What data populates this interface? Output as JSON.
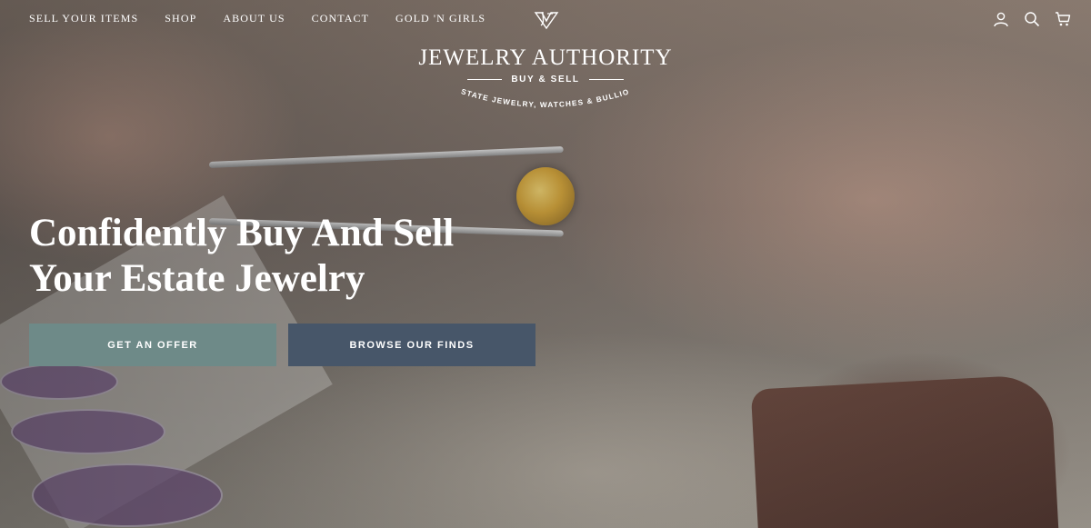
{
  "nav": {
    "items": [
      {
        "label": "SELL YOUR ITEMS"
      },
      {
        "label": "SHOP"
      },
      {
        "label": "ABOUT US"
      },
      {
        "label": "CONTACT"
      },
      {
        "label": "GOLD 'N GIRLS"
      }
    ]
  },
  "brand": {
    "title": "JEWELRY AUTHORITY",
    "subtitle": "BUY & SELL",
    "tagline": "ESTATE JEWELRY, WATCHES & BULLION",
    "logo_icon": "jv-monogram-icon"
  },
  "header_icons": [
    "account-icon",
    "search-icon",
    "cart-icon"
  ],
  "hero": {
    "title_line1": "Confidently Buy And Sell",
    "title_line2": "Your Estate Jewelry",
    "primary_button": "GET AN OFFER",
    "secondary_button": "BROWSE OUR FINDS"
  },
  "colors": {
    "primary_button": "#6e8a88",
    "secondary_button": "#475669",
    "text": "#ffffff"
  }
}
